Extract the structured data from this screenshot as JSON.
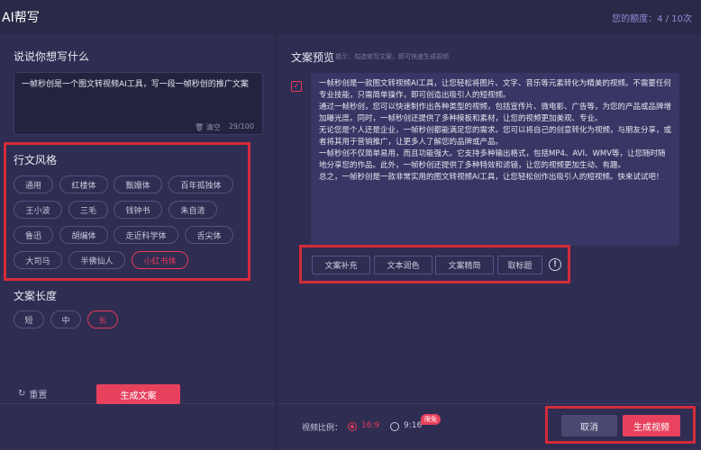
{
  "app": {
    "title": "AI帮写",
    "quota": "您的额度：4 / 10次"
  },
  "left": {
    "prompt_title": "说说你想写什么",
    "prompt_text": "一帧秒创是一个图文转视频AI工具，写一段一帧秒创的推广文案",
    "clear_label": "清空",
    "counter": "29/100",
    "style_title": "行文风格",
    "styles": [
      "通用",
      "红楼体",
      "甄嬛体",
      "百年孤独体",
      "王小波",
      "三毛",
      "钱钟书",
      "朱自清",
      "鲁迅",
      "胡编体",
      "走近科学体",
      "舌尖体",
      "大司马",
      "半佛仙人",
      "小红书体"
    ],
    "length_title": "文案长度",
    "lengths": [
      "短",
      "中",
      "长"
    ],
    "reset_label": "重置",
    "generate_label": "生成文案"
  },
  "right": {
    "preview_title": "文案预览",
    "preview_hint": "提示：勾选修写文案，即可快速生成视频",
    "paragraphs": [
      "一帧秒创是一款图文转视频AI工具，让您轻松将图片、文字、音乐等元素转化为精美的视频。不需要任何专业技能，只需简单操作，即可创造出吸引人的短视频。",
      "通过一帧秒创，您可以快速制作出各种类型的视频，包括宣传片、微电影、广告等，为您的产品或品牌增加曝光度。同时，一帧秒创还提供了多种模板和素材，让您的视频更加美观、专业。",
      "无论您是个人还是企业，一帧秒创都能满足您的需求。您可以将自己的创意转化为视频，与朋友分享，或者将其用于营销推广，让更多人了解您的品牌或产品。",
      "一帧秒创不仅简单易用，而且功能强大。它支持多种输出格式，包括MP4、AVI、WMV等，让您随时随地分享您的作品。此外，一帧秒创还提供了多种特效和滤镜，让您的视频更加生动、有趣。",
      "总之，一帧秒创是一款非常实用的图文转视频AI工具，让您轻松创作出吸引人的短视频。快来试试吧！"
    ],
    "tools": [
      "文案补充",
      "文本润色",
      "文案精简",
      "取标题"
    ],
    "info_glyph": "!",
    "ratio_label": "视频比例：",
    "ratio_options": [
      "16:9",
      "9:16"
    ],
    "limited_badge": "限免",
    "cancel_label": "取消",
    "generate_video_label": "生成视频"
  },
  "colors": {
    "accent": "#e8415e",
    "highlight": "#d42b3a",
    "background": "#2f2d52"
  }
}
